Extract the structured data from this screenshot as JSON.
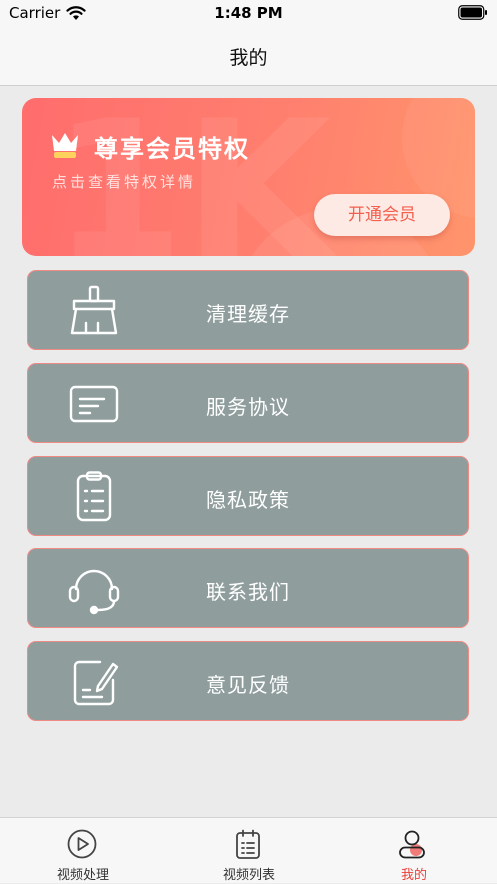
{
  "status_bar": {
    "carrier": "Carrier",
    "time": "1:48 PM"
  },
  "nav": {
    "title": "我的"
  },
  "vip": {
    "title": "尊享会员特权",
    "subtitle": "点击查看特权详情",
    "button": "开通会员",
    "accent": "#ff7a6c"
  },
  "menu": {
    "items": [
      {
        "label": "清理缓存",
        "icon": "broom-icon"
      },
      {
        "label": "服务协议",
        "icon": "document-card-icon"
      },
      {
        "label": "隐私政策",
        "icon": "clipboard-icon"
      },
      {
        "label": "联系我们",
        "icon": "headset-icon"
      },
      {
        "label": "意见反馈",
        "icon": "edit-note-icon"
      }
    ]
  },
  "tabs": [
    {
      "label": "视频处理",
      "icon": "play-circle-icon",
      "active": false
    },
    {
      "label": "视频列表",
      "icon": "calendar-list-icon",
      "active": false
    },
    {
      "label": "我的",
      "icon": "user-icon",
      "active": true
    }
  ],
  "colors": {
    "menu_bg": "#8f9e9d",
    "menu_border": "#f08a85",
    "tab_active": "#e8413a"
  }
}
